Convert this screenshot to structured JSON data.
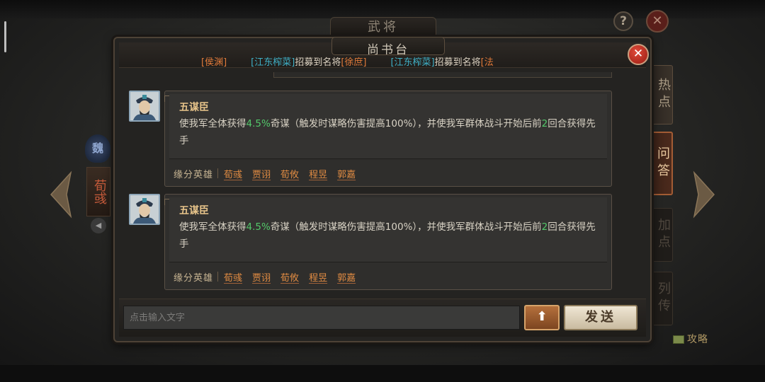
{
  "background": {
    "title": "武将",
    "help_label": "?",
    "close_label": "✕",
    "faction": "魏",
    "hero_name": "荀彧",
    "strategy_label": "攻略"
  },
  "side_tabs": [
    {
      "label": "热点",
      "active": false
    },
    {
      "label": "问答",
      "active": true
    },
    {
      "label": "加点",
      "active": false
    },
    {
      "label": "列传",
      "active": false
    }
  ],
  "panel": {
    "title": "尚书台",
    "close_label": "✕",
    "ticker": [
      {
        "prefix": "",
        "user": "",
        "text": "",
        "name": "[侯渊]"
      },
      {
        "prefix": "",
        "user": "[江东榨菜]",
        "text": "招募到名将",
        "name": "[徐庶]"
      },
      {
        "prefix": "",
        "user": "[江东榨菜]",
        "text": "招募到名将",
        "name": "[法"
      }
    ]
  },
  "messages": [
    {
      "skill_title": "五谋臣",
      "desc_a": "使我军全体获得",
      "desc_num": "4.5%",
      "desc_b": "奇谋（触发时谋略伤害提高100%），并使我军群体战斗开始后前",
      "desc_num2": "2",
      "desc_c": "回合获得先手",
      "fate_label": "缘分英雄",
      "fate_heroes": [
        "荀彧",
        "贾诩",
        "荀攸",
        "程昱",
        "郭嘉"
      ]
    },
    {
      "skill_title": "五谋臣",
      "desc_a": "使我军全体获得",
      "desc_num": "4.5%",
      "desc_b": "奇谋（触发时谋略伤害提高100%），并使我军群体战斗开始后前",
      "desc_num2": "2",
      "desc_c": "回合获得先手",
      "fate_label": "缘分英雄",
      "fate_heroes": [
        "荀彧",
        "贾诩",
        "荀攸",
        "程昱",
        "郭嘉"
      ]
    }
  ],
  "input": {
    "placeholder": "点击输入文字",
    "up_label": "⬆",
    "send_label": "发送"
  },
  "colors": {
    "accent_orange": "#e08b42",
    "highlight_green": "#53c86a",
    "user_cyan": "#3fb0c6",
    "close_red": "#c0302a"
  }
}
